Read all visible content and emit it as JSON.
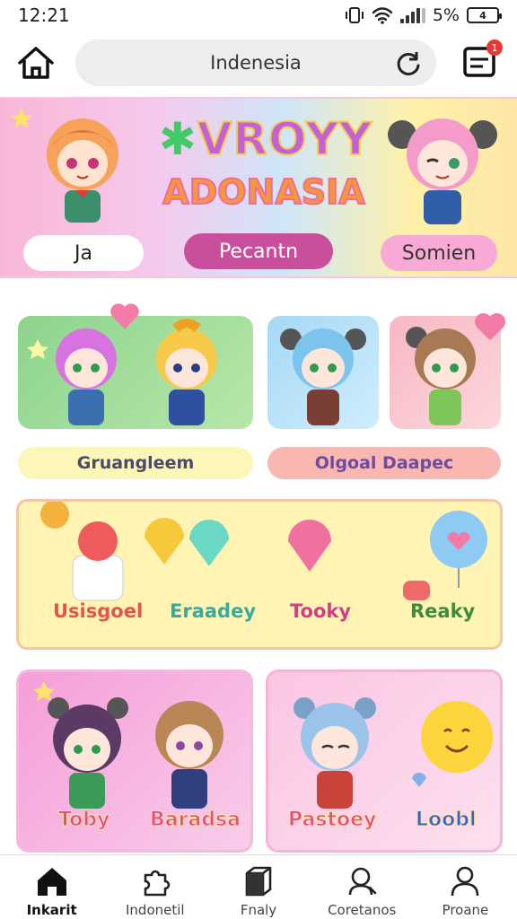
{
  "status": {
    "time": "12:21",
    "battery": "5%",
    "battery_icon_text": "4"
  },
  "browser": {
    "url": "Indenesia",
    "tab_count": "1"
  },
  "banner": {
    "title_line1": "VROYY",
    "title_line2": "ADONASIA",
    "chips": [
      "Ja",
      "Pecantn",
      "Somien"
    ]
  },
  "sections": {
    "label1": "Gruangleem",
    "label2": "Olgoal Daapec"
  },
  "yellow_card": {
    "tags": [
      "Usisgoel",
      "Eraadey",
      "Tooky",
      "Reaky"
    ]
  },
  "bottom_cards": {
    "left_names": [
      "Toby",
      "Baradsa"
    ],
    "right_names": [
      "Pastoey",
      "Loobl"
    ]
  },
  "nav": {
    "items": [
      {
        "label": "Inkarit",
        "icon": "home-icon"
      },
      {
        "label": "Indonetil",
        "icon": "puzzle-icon"
      },
      {
        "label": "Fnaly",
        "icon": "box-icon"
      },
      {
        "label": "Coretanos",
        "icon": "search-user-icon"
      },
      {
        "label": "Proane",
        "icon": "person-icon"
      }
    ]
  },
  "colors": {
    "accent": "#c94f9d",
    "banner_pink": "#f9b6d8",
    "banner_yellow": "#fff1a8"
  }
}
